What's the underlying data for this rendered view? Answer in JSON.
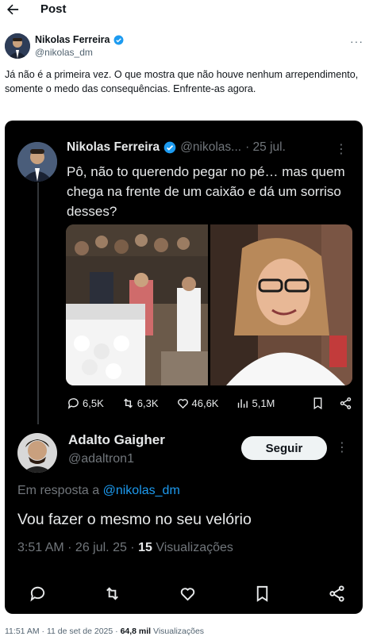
{
  "header": {
    "title": "Post"
  },
  "post": {
    "author_name": "Nikolas Ferreira",
    "author_handle": "@nikolas_dm",
    "text": "Já não é a primeira vez. O que mostra que não houve nenhum arrependimento, somente o medo das consequências. Enfrente-as agora.",
    "time": "11:51 AM",
    "date": "11 de set de 2025",
    "views_count": "64,8 mil",
    "views_label": "Visualizações"
  },
  "quoted": {
    "author_name": "Nikolas Ferreira",
    "author_handle": "@nikolas...",
    "date": "· 25 jul.",
    "text": "Pô, não to querendo pegar no pé… mas quem chega na frente de um caixão e dá um sorriso desses?",
    "replies": "6,5K",
    "reposts": "6,3K",
    "likes": "46,6K",
    "views": "5,1M"
  },
  "reply": {
    "author_name": "Adalto Gaigher",
    "author_handle": "@adaltron1",
    "follow_label": "Seguir",
    "in_reply_prefix": "Em resposta a",
    "in_reply_handle": "@nikolas_dm",
    "text": "Vou fazer o mesmo no seu velório",
    "meta_prefix": "3:51 AM · 26 jul. 25 ·",
    "views_count": "15",
    "views_label": "Visualizações"
  },
  "colors": {
    "accent": "#1d9bf0",
    "verified": "#1d9bf0",
    "dark_bg": "#000000",
    "muted": "#71767b"
  }
}
